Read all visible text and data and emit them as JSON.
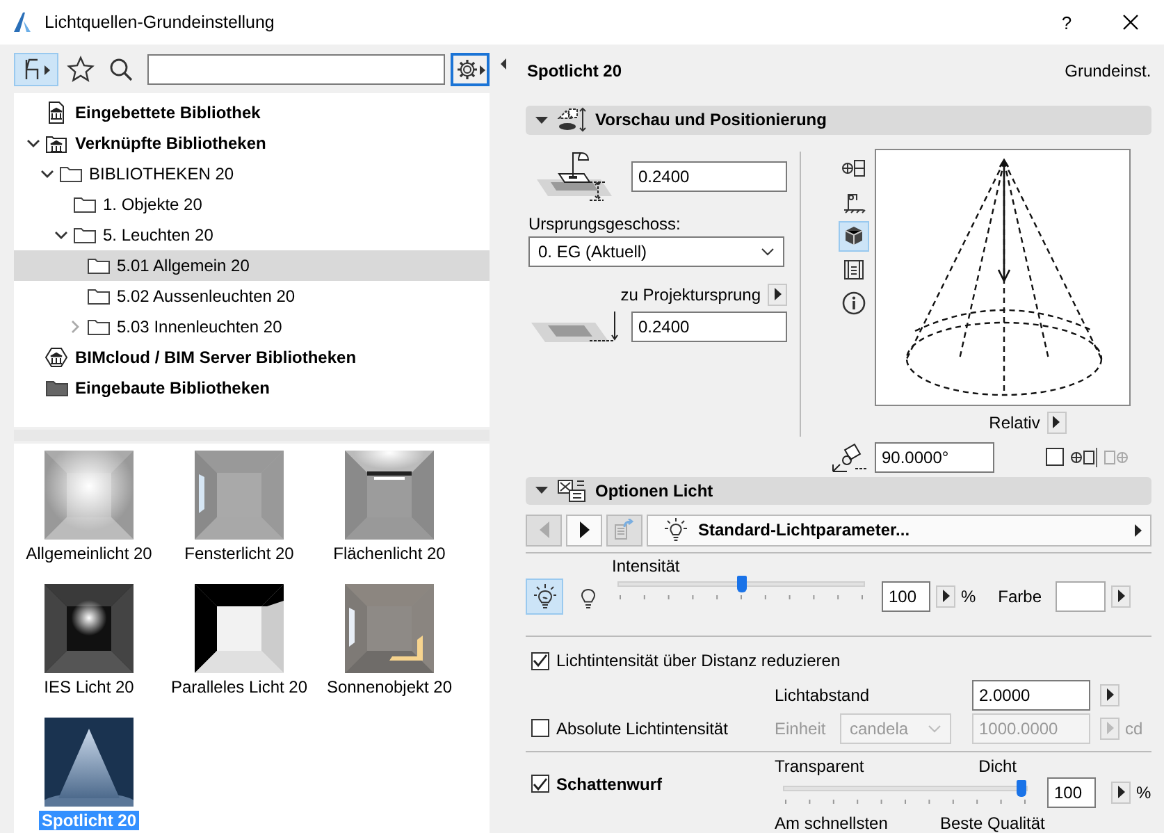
{
  "window": {
    "title": "Lichtquellen-Grundeinstellung",
    "help": "?"
  },
  "library": {
    "tree": [
      {
        "label": "Eingebettete Bibliothek",
        "kind": "embedded",
        "selected": false
      },
      {
        "label": "Verknüpfte Bibliotheken",
        "kind": "linked",
        "selected": false,
        "expanded": true,
        "children": [
          {
            "label": "BIBLIOTHEKEN 20",
            "kind": "folder",
            "selected": false,
            "expanded": true,
            "children": [
              {
                "label": "1. Objekte 20",
                "kind": "folder",
                "selected": false
              },
              {
                "label": "5. Leuchten 20",
                "kind": "folder",
                "selected": false,
                "expanded": true,
                "children": [
                  {
                    "label": "5.01 Allgemein 20",
                    "kind": "folder",
                    "selected": true
                  },
                  {
                    "label": "5.02 Aussenleuchten 20",
                    "kind": "folder",
                    "selected": false
                  },
                  {
                    "label": "5.03 Innenleuchten 20",
                    "kind": "folder",
                    "selected": false,
                    "expanded": false
                  }
                ]
              }
            ]
          }
        ]
      },
      {
        "label": "BIMcloud / BIM Server Bibliotheken",
        "kind": "bimcloud",
        "selected": false
      },
      {
        "label": "Eingebaute Bibliotheken",
        "kind": "builtin",
        "selected": false
      }
    ],
    "items": [
      {
        "label": "Allgemeinlicht 20",
        "kind": "general",
        "selected": false
      },
      {
        "label": "Fensterlicht 20",
        "kind": "window",
        "selected": false
      },
      {
        "label": "Flächenlicht 20",
        "kind": "area",
        "selected": false
      },
      {
        "label": "IES Licht 20",
        "kind": "ies",
        "selected": false
      },
      {
        "label": "Paralleles Licht 20",
        "kind": "parallel",
        "selected": false
      },
      {
        "label": "Sonnenobjekt 20",
        "kind": "sun",
        "selected": false
      },
      {
        "label": "Spotlicht 20",
        "kind": "spot",
        "selected": true
      }
    ]
  },
  "settings": {
    "header": {
      "title": "Spotlicht 20",
      "mode": "Grundeinst."
    },
    "preview": {
      "title": "Vorschau und Positionierung",
      "expanded": true,
      "height_value": "0.2400",
      "story_label": "Ursprungsgeschoss:",
      "story_value": "0. EG (Aktuell)",
      "origin_label": "zu Projektursprung",
      "origin_value": "0.2400",
      "view_buttons": [
        {
          "kind": "symbol",
          "selected": false
        },
        {
          "kind": "section",
          "selected": false
        },
        {
          "kind": "perspective",
          "selected": true
        },
        {
          "kind": "list",
          "selected": false
        },
        {
          "kind": "info",
          "selected": false
        }
      ],
      "relative_label": "Relativ",
      "angle_value": "90.0000°",
      "mirror_checked": false
    },
    "light": {
      "title": "Optionen Licht",
      "expanded": true,
      "nav_buttons": [
        {
          "kind": "back",
          "disabled": true
        },
        {
          "kind": "forward",
          "disabled": false
        },
        {
          "kind": "transfer",
          "disabled": true
        }
      ],
      "preset": "Standard-Lichtparameter...",
      "light_modes": [
        {
          "kind": "on",
          "selected": true
        },
        {
          "kind": "off",
          "selected": false
        }
      ],
      "intensity_label": "Intensität",
      "intensity": {
        "level": 0.5,
        "value": "100",
        "unit": "%"
      },
      "color_label": "Farbe",
      "falloff": {
        "label": "Lichtintensität über Distanz reduzieren",
        "checked": true
      },
      "distance_label": "Lichtabstand",
      "distance_value": "2.0000",
      "absolute": {
        "label": "Absolute Lichtintensität",
        "checked": false
      },
      "unit_label": "Einheit",
      "unit_value": "candela",
      "absolute_value": "1000.0000",
      "absolute_unit": "cd",
      "shadow": {
        "label": "Schattenwurf",
        "checked": true,
        "left_label": "Transparent",
        "right_label": "Dicht",
        "level": 1.0,
        "value": "100",
        "unit": "%"
      },
      "quality": {
        "left_label": "Am schnellsten",
        "right_label": "Beste Qualität"
      }
    }
  }
}
